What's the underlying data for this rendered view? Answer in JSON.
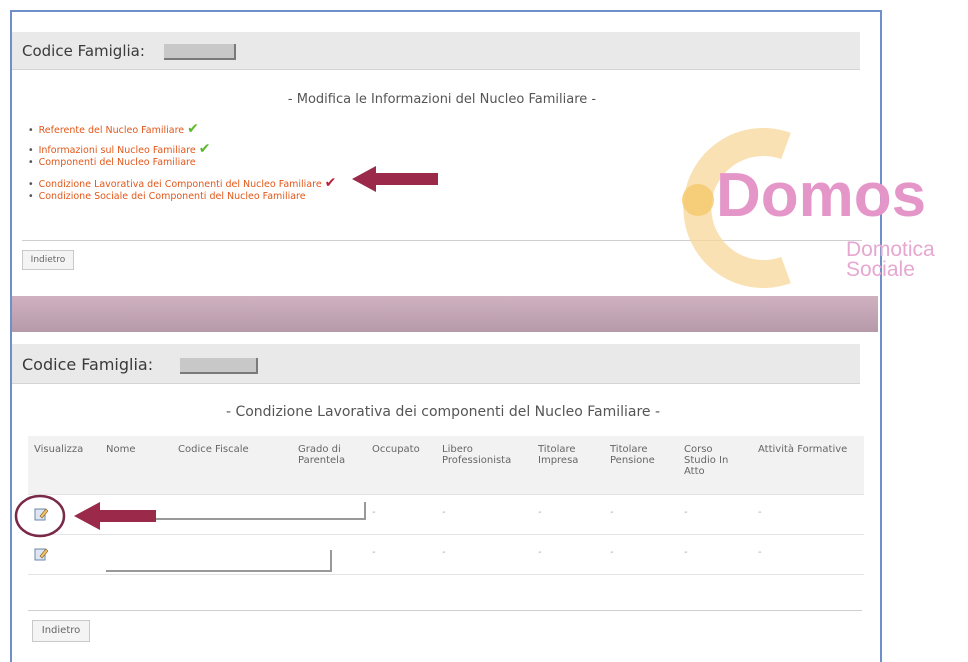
{
  "top": {
    "header_label": "Codice Famiglia:",
    "title": "- Modifica le Informazioni del Nucleo Familiare -",
    "links": [
      {
        "label": "Referente del Nucleo Familiare",
        "check": "green"
      },
      {
        "label": "Informazioni sul Nucleo Familiare",
        "check": "green"
      },
      {
        "label": "Componenti del Nucleo Familiare",
        "check": ""
      },
      {
        "label": "Condizione Lavorativa dei Componenti del Nucleo Familiare",
        "check": "red"
      },
      {
        "label": "Condizione Sociale dei Componenti del Nucleo Familiare",
        "check": ""
      }
    ],
    "back_label": "Indietro"
  },
  "bottom": {
    "header_label": "Codice Famiglia:",
    "title": "- Condizione Lavorativa dei componenti del Nucleo Familiare -",
    "columns": [
      "Visualizza",
      "Nome",
      "Codice Fiscale",
      "Grado di Parentela",
      "Occupato",
      "Libero Professionista",
      "Titolare Impresa",
      "Titolare Pensione",
      "Corso Studio In Atto",
      "Attività Formative"
    ],
    "rows": [
      [
        "",
        "",
        "",
        "",
        "-",
        "-",
        "-",
        "-",
        "-",
        "-"
      ],
      [
        "",
        "",
        "",
        "",
        "-",
        "-",
        "-",
        "-",
        "-",
        "-"
      ]
    ],
    "back_label": "Indietro"
  },
  "logo": {
    "name": "Domos",
    "line1": "Domotica",
    "line2": "Sociale"
  },
  "colors": {
    "link": "#e2571a",
    "check_ok": "#5cb82a",
    "check_current": "#b8233f",
    "arrow": "#9b2a4a",
    "logo_pink": "#e08cc4",
    "logo_ring": "#f5b94a",
    "frame": "#6f8fc8"
  },
  "icons": [
    "edit-icon",
    "check-icon",
    "arrow-icon"
  ]
}
